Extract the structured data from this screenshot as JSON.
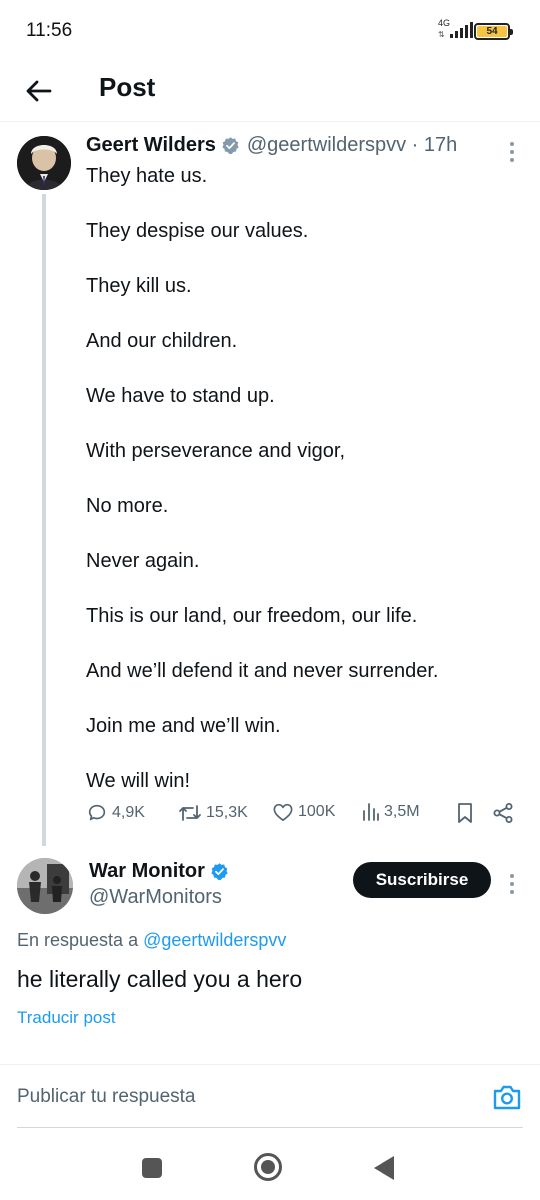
{
  "status_bar": {
    "time": "11:56",
    "network": "4G",
    "battery": "54"
  },
  "header": {
    "title": "Post"
  },
  "tweet": {
    "author_name": "Geert Wilders",
    "handle": "@geertwilderspvv · 17h",
    "lines": [
      "They hate us.",
      "They despise our values.",
      "They kill us.",
      "And our children.",
      "We have to stand up.",
      "With perseverance and vigor,",
      "No more.",
      "Never again.",
      "This is our land, our freedom, our life.",
      "And we’ll defend it and never surrender.",
      "Join me and we’ll win.",
      "We will win!"
    ],
    "stats": {
      "replies": "4,9K",
      "reposts": "15,3K",
      "likes": "100K",
      "views": "3,5M"
    }
  },
  "reply": {
    "author_name": "War Monitor",
    "handle": "@WarMonitors",
    "subscribe_label": "Suscribirse",
    "in_reply_prefix": "En respuesta a",
    "in_reply_handle": "@geertwilderspvv",
    "text": "he literally called you a hero",
    "translate_label": "Traducir post"
  },
  "compose": {
    "placeholder": "Publicar tu respuesta"
  },
  "colors": {
    "accent": "#1d9bf0",
    "text": "#0f1419",
    "secondary": "#536471"
  }
}
